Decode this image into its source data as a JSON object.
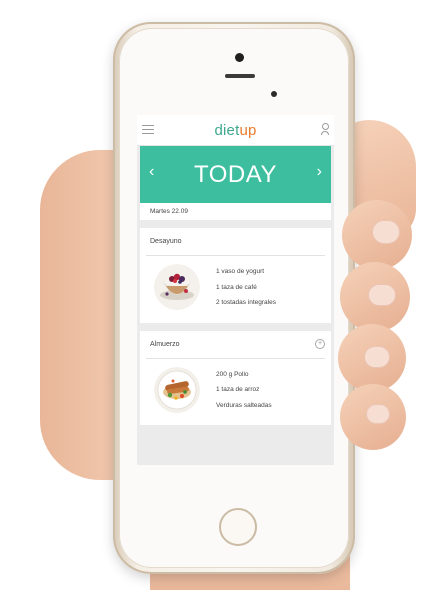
{
  "app": {
    "logo_part1": "diet",
    "logo_part2": "up"
  },
  "banner": {
    "title": "TODAY",
    "prev": "‹",
    "next": "›"
  },
  "date": "Martes 22.09",
  "meals": [
    {
      "name": "Desayuno",
      "items": [
        "1 vaso de yogurt",
        "1 taza de café",
        "2 tostadas integrales"
      ]
    },
    {
      "name": "Almuerzo",
      "add": "+",
      "items": [
        "200 g Pollo",
        "1 taza de arroz",
        "Verduras salteadas"
      ]
    }
  ],
  "colors": {
    "accent": "#3dbf9f",
    "logo_green": "#3fa88c",
    "logo_orange": "#e97b2b"
  }
}
